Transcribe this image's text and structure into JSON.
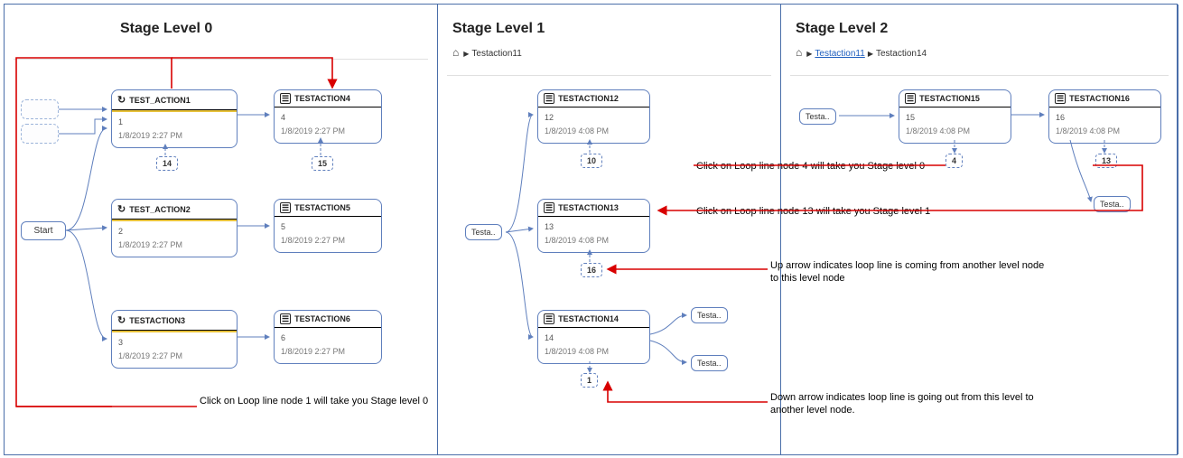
{
  "panels": {
    "level0": {
      "title": "Stage Level 0"
    },
    "level1": {
      "title": "Stage Level 1",
      "breadcrumb": {
        "current": "Testaction11"
      }
    },
    "level2": {
      "title": "Stage Level 2",
      "breadcrumb": {
        "link": "Testaction11",
        "current": "Testaction14"
      }
    }
  },
  "start_label": "Start",
  "mini_label": "Testa..",
  "cards": {
    "a1": {
      "title": "TEST_ACTION1",
      "id": "1",
      "ts": "1/8/2019 2:27 PM"
    },
    "a2": {
      "title": "TEST_ACTION2",
      "id": "2",
      "ts": "1/8/2019 2:27 PM"
    },
    "a3": {
      "title": "TESTACTION3",
      "id": "3",
      "ts": "1/8/2019 2:27 PM"
    },
    "a4": {
      "title": "TESTACTION4",
      "id": "4",
      "ts": "1/8/2019 2:27 PM"
    },
    "a5": {
      "title": "TESTACTION5",
      "id": "5",
      "ts": "1/8/2019 2:27 PM"
    },
    "a6": {
      "title": "TESTACTION6",
      "id": "6",
      "ts": "1/8/2019 2:27 PM"
    },
    "a12": {
      "title": "TESTACTION12",
      "id": "12",
      "ts": "1/8/2019 4:08 PM"
    },
    "a13": {
      "title": "TESTACTION13",
      "id": "13",
      "ts": "1/8/2019 4:08 PM"
    },
    "a14": {
      "title": "TESTACTION14",
      "id": "14",
      "ts": "1/8/2019 4:08 PM"
    },
    "a15": {
      "title": "TESTACTION15",
      "id": "15",
      "ts": "1/8/2019 4:08 PM"
    },
    "a16": {
      "title": "TESTACTION16",
      "id": "16",
      "ts": "1/8/2019 4:08 PM"
    }
  },
  "loop_badges": {
    "b14": "14",
    "b15": "15",
    "b10": "10",
    "b16": "16",
    "b1": "1",
    "b4": "4",
    "b13": "13"
  },
  "annotations": {
    "n4": "Click on Loop line node 4 will take you Stage level 0",
    "n13": "Click on Loop line node 13 will take you Stage level 1",
    "up": "Up arrow indicates loop line is coming from another level node to this level node",
    "n1": "Click on Loop line node 1 will take you Stage level 0",
    "down": "Down arrow indicates loop line is going out from this level to another level node."
  }
}
